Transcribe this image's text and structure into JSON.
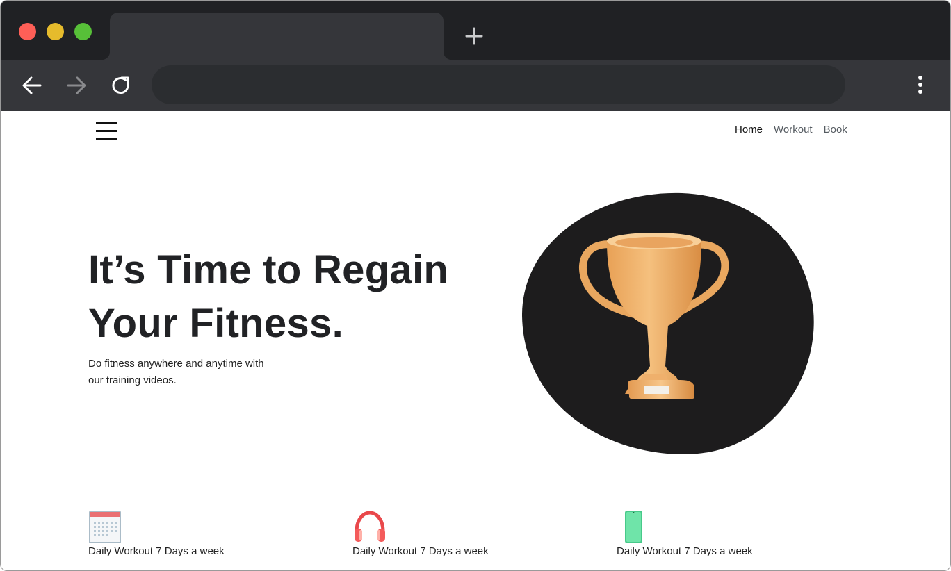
{
  "browser": {
    "new_tab_icon": "plus-icon",
    "back_icon": "arrow-left-icon",
    "forward_icon": "arrow-right-icon",
    "reload_icon": "reload-icon",
    "menu_icon": "kebab-menu-icon",
    "colors": {
      "frame": "#202124",
      "tab": "#35363a",
      "omnibox": "#2b2d30"
    }
  },
  "header": {
    "menu_icon": "hamburger-icon",
    "nav": [
      {
        "label": "Home",
        "active": true
      },
      {
        "label": "Workout",
        "active": false
      },
      {
        "label": "Book",
        "active": false
      }
    ]
  },
  "hero": {
    "title_line1": "It’s Time to Regain",
    "title_line2": "Your Fitness.",
    "subtitle_line1": "Do fitness anywhere and anytime with",
    "subtitle_line2": "our training videos.",
    "image": "trophy-illustration"
  },
  "features": [
    {
      "icon": "calendar-icon",
      "label": "Daily Workout 7 Days a week"
    },
    {
      "icon": "headphones-icon",
      "label": "Daily Workout 7 Days a week"
    },
    {
      "icon": "phone-icon",
      "label": "Daily Workout 7 Days a week"
    }
  ]
}
